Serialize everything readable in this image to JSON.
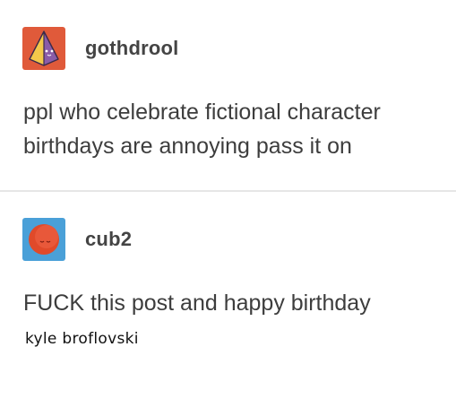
{
  "posts": [
    {
      "username": "gothdrool",
      "avatar_icon": "pyramid-icon",
      "text": "ppl who celebrate fictional character birthdays are annoying pass it on"
    },
    {
      "username": "cub2",
      "avatar_icon": "moon-face-icon",
      "text": "FUCK this post and happy birthday",
      "handwritten_caption": "kyle broflovski"
    }
  ],
  "colors": {
    "avatar1_bg": "#e05a3a",
    "avatar2_bg": "#4aa0d8",
    "moon": "#e04a2a"
  }
}
